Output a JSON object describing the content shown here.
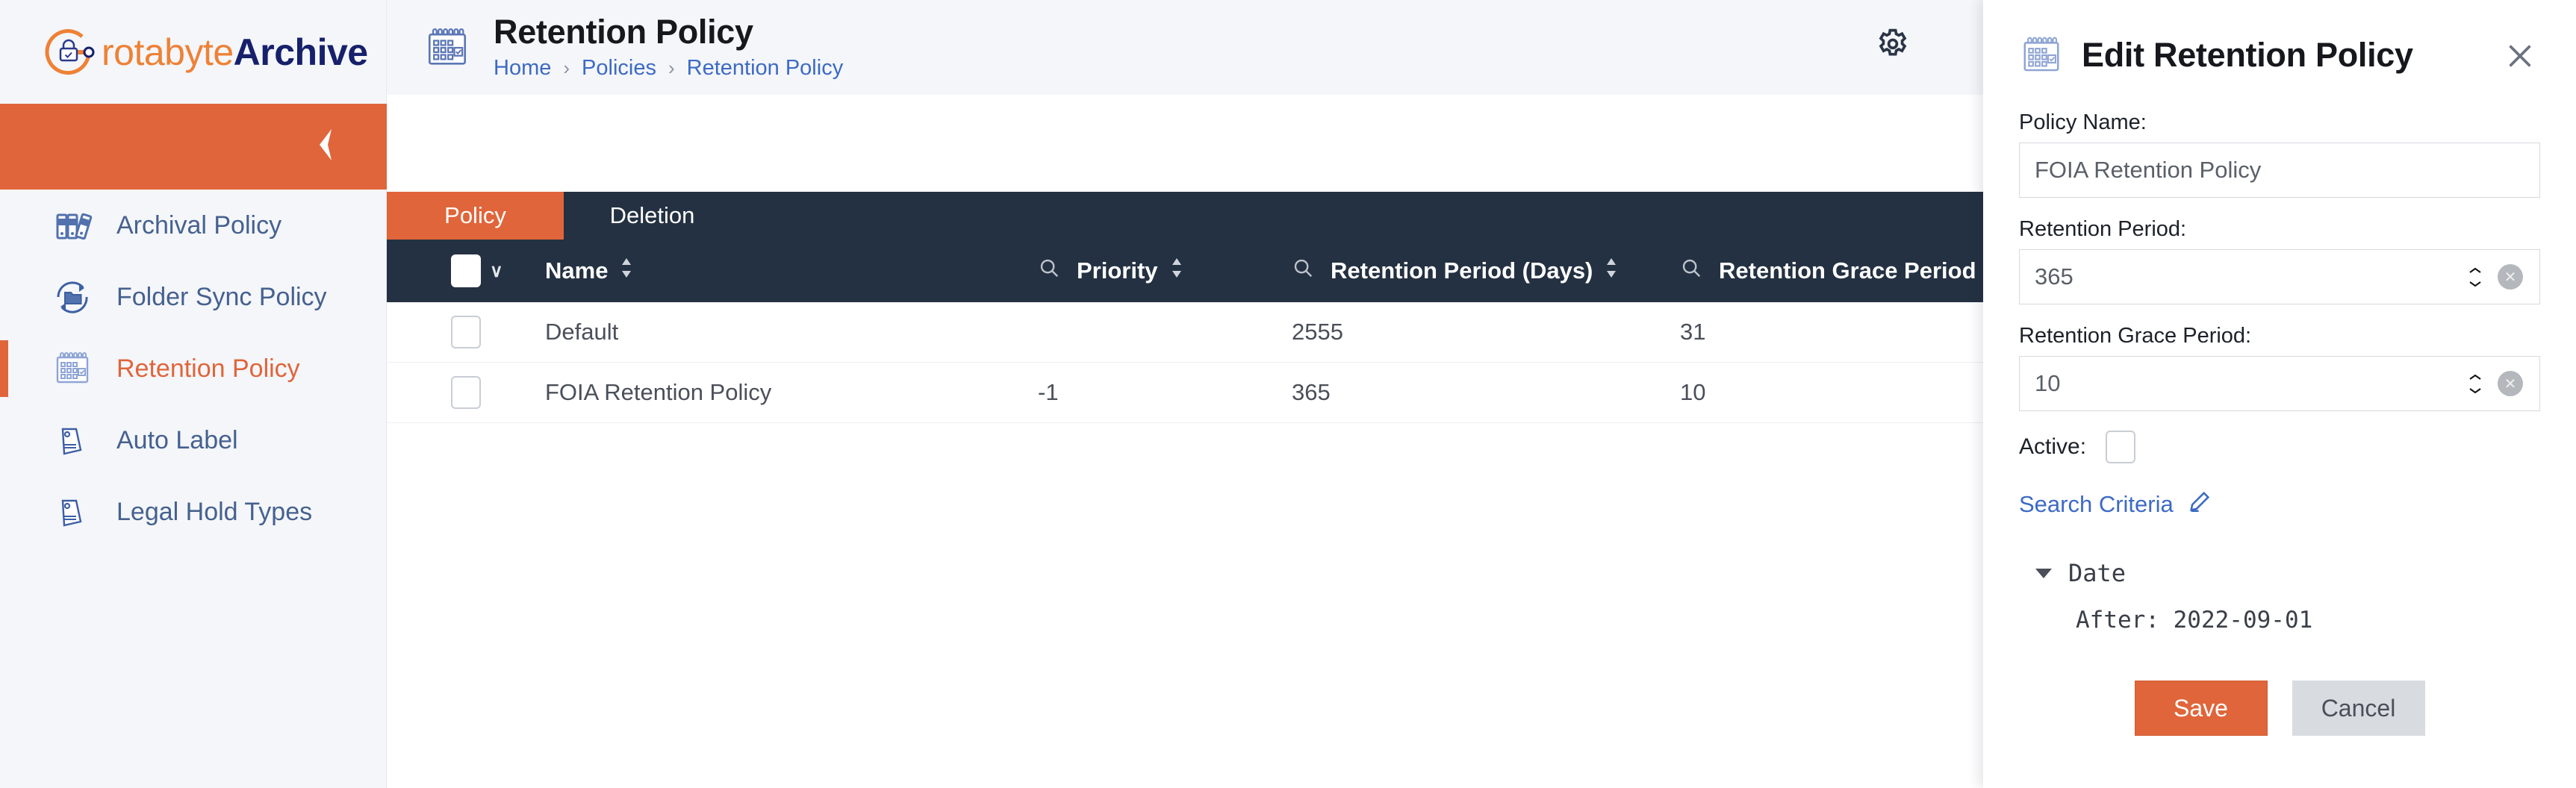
{
  "brand": {
    "name_part1": "rotabyte",
    "name_part2": "Archive",
    "logo_icon": "lock-circle-logo"
  },
  "sidebar": {
    "collapse_icon": "chevron-left-icon",
    "items": [
      {
        "label": "Archival Policy",
        "icon": "binders-icon",
        "active": false
      },
      {
        "label": "Folder Sync Policy",
        "icon": "folder-sync-icon",
        "active": false
      },
      {
        "label": "Retention Policy",
        "icon": "calendar-check-icon",
        "active": true
      },
      {
        "label": "Auto Label",
        "icon": "tag-icon",
        "active": false
      },
      {
        "label": "Legal Hold Types",
        "icon": "tag-icon",
        "active": false
      }
    ]
  },
  "header": {
    "icon": "calendar-check-icon",
    "title": "Retention Policy",
    "breadcrumb": [
      "Home",
      "Policies",
      "Retention Policy"
    ],
    "separator": "›",
    "gear_icon": "gear-icon"
  },
  "tabs": [
    {
      "label": "Policy",
      "active": true
    },
    {
      "label": "Deletion",
      "active": false
    }
  ],
  "table": {
    "select_all_caret": "chevron-down-icon",
    "search_icon": "search-icon",
    "sort_icon": "sort-updown-icon",
    "columns": [
      {
        "label": "Name",
        "sortable": true,
        "searchable": false
      },
      {
        "label": "Priority",
        "sortable": true,
        "searchable": true
      },
      {
        "label": "Retention Period (Days)",
        "sortable": true,
        "searchable": true
      },
      {
        "label": "Retention Grace Period (Da",
        "sortable": false,
        "searchable": true
      }
    ],
    "rows": [
      {
        "name": "Default",
        "priority": "",
        "retention_period": "2555",
        "retention_grace_period": "31"
      },
      {
        "name": "FOIA Retention Policy",
        "priority": "-1",
        "retention_period": "365",
        "retention_grace_period": "10"
      }
    ]
  },
  "panel": {
    "icon": "calendar-check-icon",
    "title": "Edit Retention Policy",
    "close_icon": "close-icon",
    "policy_name": {
      "label": "Policy Name:",
      "value": "FOIA Retention Policy",
      "placeholder": ""
    },
    "retention_period": {
      "label": "Retention Period:",
      "value": "365",
      "spinner_icon": "spinner-updown-icon",
      "clear_icon": "clear-x-icon"
    },
    "retention_grace_period": {
      "label": "Retention Grace Period:",
      "value": "10",
      "spinner_icon": "spinner-updown-icon",
      "clear_icon": "clear-x-icon"
    },
    "active": {
      "label": "Active:",
      "checked": false
    },
    "search_criteria": {
      "label": "Search Criteria",
      "edit_icon": "pencil-icon"
    },
    "criteria": {
      "group_label": "Date",
      "caret_icon": "caret-down-icon",
      "value": "After: 2022‑09‑01"
    },
    "save_label": "Save",
    "cancel_label": "Cancel"
  },
  "colors": {
    "accent_orange": "#e0653a",
    "brand_navy": "#16206b",
    "dark_header": "#243142",
    "link_blue": "#3d6ac4",
    "sidebar_bg": "#f4f6fa",
    "nav_text": "#46618f"
  }
}
